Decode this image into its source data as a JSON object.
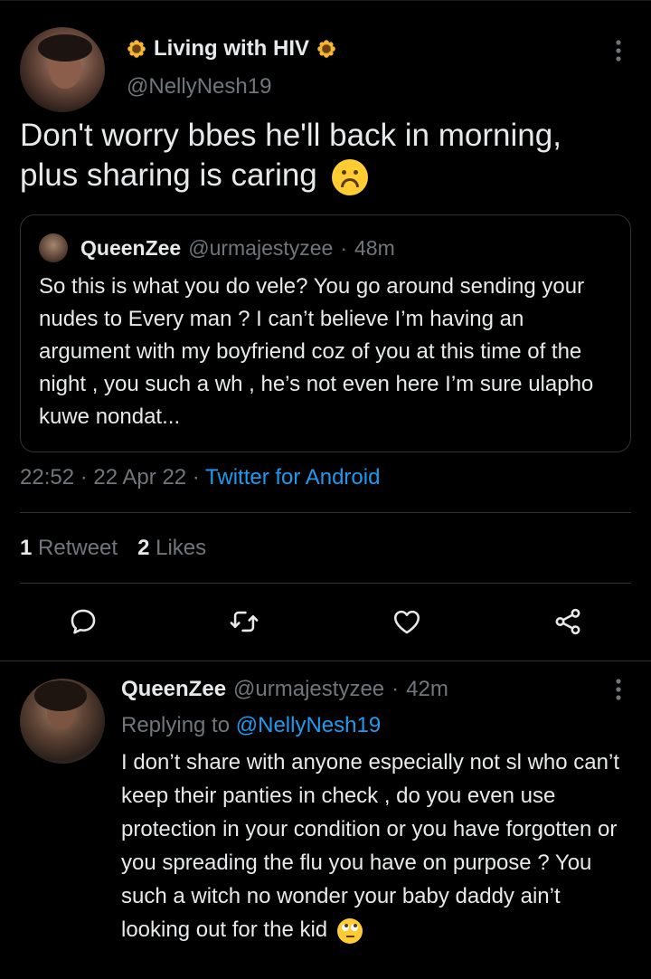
{
  "tweet": {
    "display_name": "Living with HIV",
    "sunflower_icon": "sunflower-icon",
    "handle": "@NellyNesh19",
    "text": "Don't worry bbes he'll back in morning, plus sharing is caring",
    "upside_down_emoji": "upside-down-face-emoji",
    "quoted": {
      "display_name": "QueenZee",
      "handle": "@urmajestyzee",
      "dot": "·",
      "time": "48m",
      "text": "So this is what you do vele? You go around sending your nudes to Every man ? I can’t believe I’m having an argument with my boyfriend coz of you at this time of the night , you such a wh ,  he’s not even here I’m sure ulapho kuwe nondat..."
    },
    "timestamp": "22:52 · 22 Apr 22 ·",
    "source": "Twitter for Android",
    "retweet_count": "1",
    "retweet_label": "Retweet",
    "like_count": "2",
    "like_label": "Likes"
  },
  "actions": [
    "reply-icon",
    "retweet-icon",
    "like-icon",
    "share-icon"
  ],
  "reply": {
    "display_name": "QueenZee",
    "handle": "@urmajestyzee",
    "dot": "·",
    "time": "42m",
    "replying_prefix": "Replying to",
    "replying_to": "@NellyNesh19",
    "text": "I don’t share with anyone especially not sl who can’t keep their panties in check , do you even use protection in your condition or you have forgotten or you spreading the flu you have on purpose ? You such a witch no wonder your baby daddy ain’t looking out for the kid",
    "emoji": "eye-roll-emoji"
  },
  "colors": {
    "background": "#000000",
    "text": "#e7e9ea",
    "muted": "#71767b",
    "accent": "#1d9bf0",
    "divider": "#2f3336"
  }
}
